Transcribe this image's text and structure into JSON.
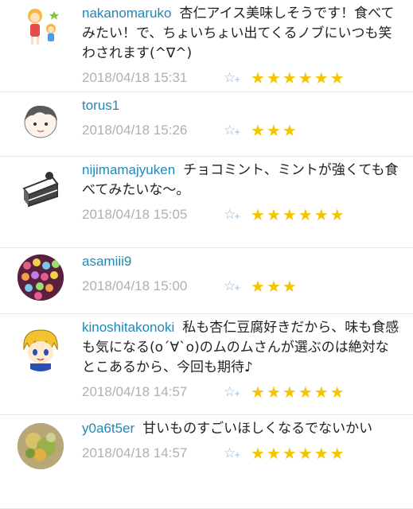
{
  "comments": [
    {
      "user": "nakanomaruko",
      "message": "杏仁アイス美味しそうです！食べてみたい！で、ちょいちょい出てくるノブにいつも笑わされます(^∇^)",
      "date": "2018/04/18 15:31",
      "stars": 6,
      "avatar_icon": "girl-character-icon",
      "avatar_color": "#f6b73c"
    },
    {
      "user": "torus1",
      "message": "",
      "date": "2018/04/18 15:26",
      "stars": 3,
      "avatar_icon": "boy-face-icon",
      "avatar_color": "#555555"
    },
    {
      "user": "nijimamajyuken",
      "message": "チョコミント、ミントが強くても食べてみたいな〜。",
      "date": "2018/04/18 15:05",
      "stars": 6,
      "avatar_icon": "cake-slice-icon",
      "avatar_color": "#333333"
    },
    {
      "user": "asamiii9",
      "message": "",
      "date": "2018/04/18 15:00",
      "stars": 3,
      "avatar_icon": "candy-photo-icon",
      "avatar_color": "#c2557a"
    },
    {
      "user": "kinoshitakonoki",
      "message": "私も杏仁豆腐好きだから、味も食感も気になる(o´∀`o)のムのムさんが選ぶのは絶対なとこあるから、今回も期待♪",
      "date": "2018/04/18 14:57",
      "stars": 6,
      "avatar_icon": "blond-character-icon",
      "avatar_color": "#f2c230"
    },
    {
      "user": "y0a6t5er",
      "message": "甘いものすごいほしくなるでないかい",
      "date": "2018/04/18 14:57",
      "stars": 6,
      "avatar_icon": "flower-photo-icon",
      "avatar_color": "#9a8a60"
    }
  ],
  "star_add_label": "☆+",
  "star_glyph": "★",
  "colors": {
    "username": "#1e88b9",
    "date": "#b0b0b0",
    "star": "#f3c400",
    "star_add": "#8fb8dd"
  }
}
